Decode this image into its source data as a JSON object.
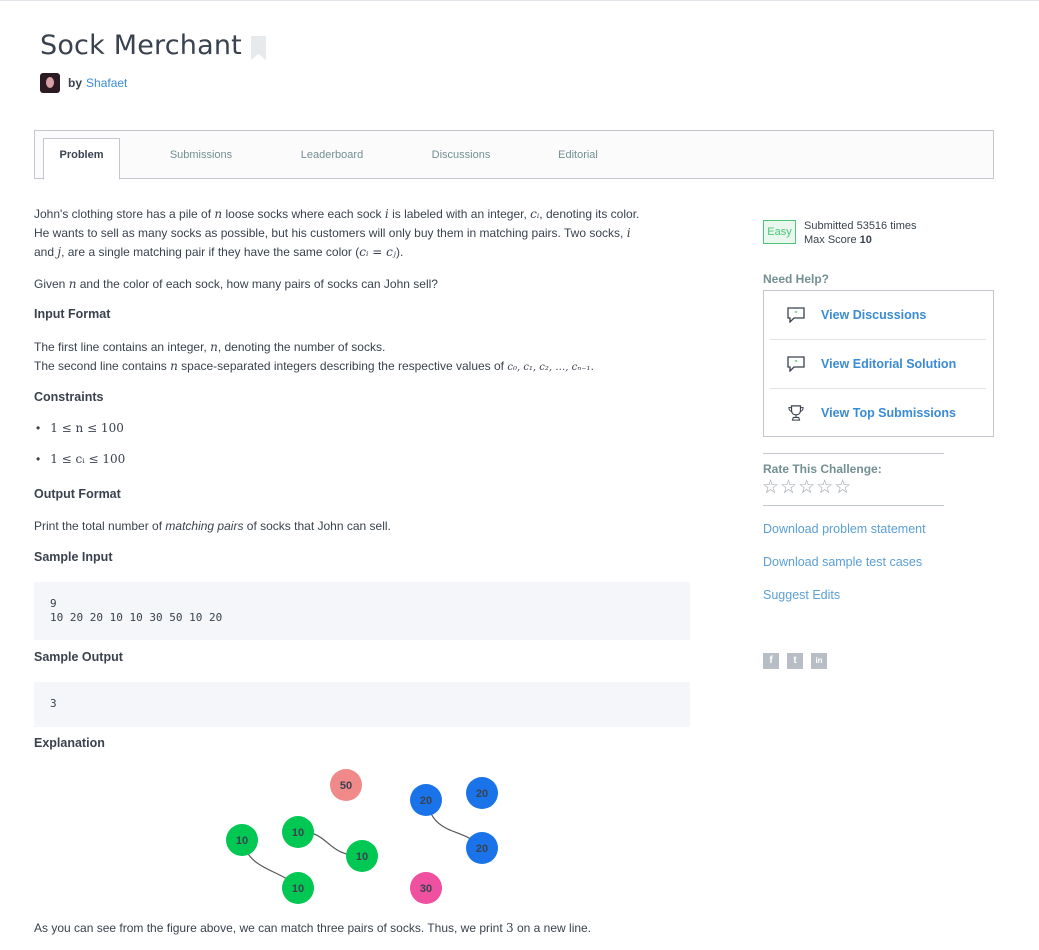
{
  "header": {
    "title": "Sock Merchant",
    "by": "by",
    "author": "Shafaet"
  },
  "tabs": [
    {
      "label": "Problem",
      "active": true
    },
    {
      "label": "Submissions",
      "active": false
    },
    {
      "label": "Leaderboard",
      "active": false
    },
    {
      "label": "Discussions",
      "active": false
    },
    {
      "label": "Editorial",
      "active": false
    }
  ],
  "problem": {
    "intro_line1_a": "John's clothing store has a pile of ",
    "intro_line1_b": " loose socks where each sock ",
    "intro_line1_c": " is labeled with an integer, ",
    "intro_line1_d": ", denoting its color.",
    "intro_line2_a": "He wants to sell as many socks as possible, but his customers will only buy them in matching pairs. Two socks, ",
    "intro_line3_a": "and ",
    "intro_line3_b": ", are a single matching pair if they have the same color (",
    "intro_line3_c": ").",
    "question_a": "Given ",
    "question_b": " and the color of each sock, how many pairs of socks can John sell?",
    "input_format_heading": "Input Format",
    "input_line1_a": "The first line contains an integer, ",
    "input_line1_b": ", denoting the number of socks.",
    "input_line2_a": "The second line contains ",
    "input_line2_b": " space-separated integers describing the respective values of ",
    "input_line2_c": ".",
    "constraints_heading": "Constraints",
    "constraint1": "1 ≤ n ≤ 100",
    "constraint2": "1 ≤ cᵢ ≤ 100",
    "output_format_heading": "Output Format",
    "output_a": "Print the total number of ",
    "output_b": "matching pairs",
    "output_c": " of socks that John can sell.",
    "sample_input_heading": "Sample Input",
    "sample_input_line1": "9",
    "sample_input_line2": "10 20 20 10 10 30 50 10 20",
    "sample_output_heading": "Sample Output",
    "sample_output": "3",
    "explanation_heading": "Explanation",
    "conclusion_a": "As you can see from the figure above, we can match three pairs of socks. Thus, we print ",
    "conclusion_b": "3",
    "conclusion_c": " on a new line.",
    "math": {
      "n": "n",
      "i": "i",
      "ci": "cᵢ",
      "j": "j",
      "eq": "cᵢ = cⱼ",
      "seq": "c₀, c₁, c₂, …, cₙ₋₁"
    }
  },
  "figure": {
    "socks": [
      {
        "label": "50",
        "color": "#f08a8a"
      },
      {
        "label": "20",
        "color": "#1a73e8"
      },
      {
        "label": "20",
        "color": "#1a73e8"
      },
      {
        "label": "10",
        "color": "#00c853"
      },
      {
        "label": "10",
        "color": "#00c853"
      },
      {
        "label": "10",
        "color": "#00c853"
      },
      {
        "label": "20",
        "color": "#1a73e8"
      },
      {
        "label": "10",
        "color": "#00c853"
      },
      {
        "label": "30",
        "color": "#f050a0"
      }
    ]
  },
  "sidebar": {
    "difficulty": "Easy",
    "submitted": "Submitted 53516 times",
    "max_score_label": "Max Score",
    "max_score": "10",
    "need_help": "Need Help?",
    "help_items": [
      {
        "label": "View Discussions",
        "icon": "speech-bubble-icon"
      },
      {
        "label": "View Editorial Solution",
        "icon": "speech-bubble-icon"
      },
      {
        "label": "View Top Submissions",
        "icon": "trophy-icon"
      }
    ],
    "rate_label": "Rate This Challenge:",
    "stars": "☆☆☆☆☆",
    "download_statement": "Download problem statement",
    "download_tests": "Download sample test cases",
    "suggest_edits": "Suggest Edits",
    "social": {
      "facebook": "f",
      "twitter": "t",
      "linkedin": "in"
    }
  }
}
